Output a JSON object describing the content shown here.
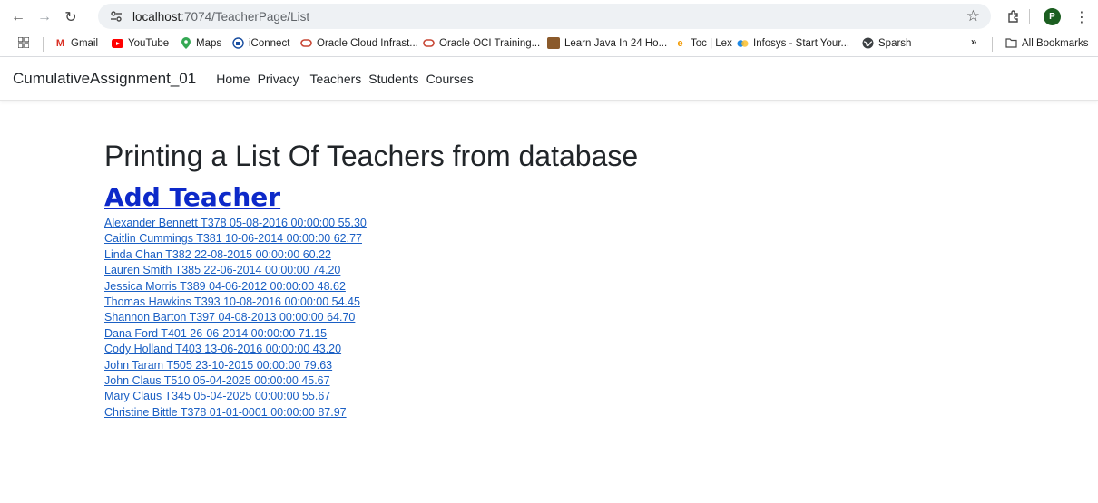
{
  "browser": {
    "url_host": "localhost",
    "url_rest": ":7074/TeacherPage/List",
    "profile_initial": "P",
    "bookmarks": [
      {
        "label": "Gmail",
        "icon": "gmail-icon"
      },
      {
        "label": "YouTube",
        "icon": "youtube-icon"
      },
      {
        "label": "Maps",
        "icon": "maps-icon"
      },
      {
        "label": "iConnect",
        "icon": "iconnect-icon"
      },
      {
        "label": "Oracle Cloud Infrast...",
        "icon": "oracle-icon"
      },
      {
        "label": "Oracle OCI Training...",
        "icon": "oracle-icon"
      },
      {
        "label": "Learn Java In 24 Ho...",
        "icon": "java-icon"
      },
      {
        "label": "Toc | Lex",
        "icon": "lex-icon"
      },
      {
        "label": "Infosys - Start Your...",
        "icon": "infosys-icon"
      },
      {
        "label": "Sparsh",
        "icon": "globe-icon"
      }
    ],
    "more_bookmarks": "»",
    "all_bookmarks": "All Bookmarks"
  },
  "navbar": {
    "brand": "CumulativeAssignment_01",
    "links": [
      "Home",
      "Privacy",
      "Teachers",
      "Students",
      "Courses"
    ]
  },
  "main": {
    "heading": "Printing a List Of Teachers from database",
    "add_link": "Add Teacher",
    "teachers": [
      "Alexander Bennett T378 05-08-2016 00:00:00 55.30",
      "Caitlin Cummings T381 10-06-2014 00:00:00 62.77",
      "Linda Chan T382 22-08-2015 00:00:00 60.22",
      "Lauren Smith T385 22-06-2014 00:00:00 74.20",
      "Jessica Morris T389 04-06-2012 00:00:00 48.62",
      "Thomas Hawkins T393 10-08-2016 00:00:00 54.45",
      "Shannon Barton T397 04-08-2013 00:00:00 64.70",
      "Dana Ford T401 26-06-2014 00:00:00 71.15",
      "Cody Holland T403 13-06-2016 00:00:00 43.20",
      "John Taram T505 23-10-2015 00:00:00 79.63",
      "John Claus T510 05-04-2025 00:00:00 45.67",
      "Mary Claus T345 05-04-2025 00:00:00 55.67",
      "Christine Bittle T378 01-01-0001 00:00:00 87.97"
    ]
  }
}
